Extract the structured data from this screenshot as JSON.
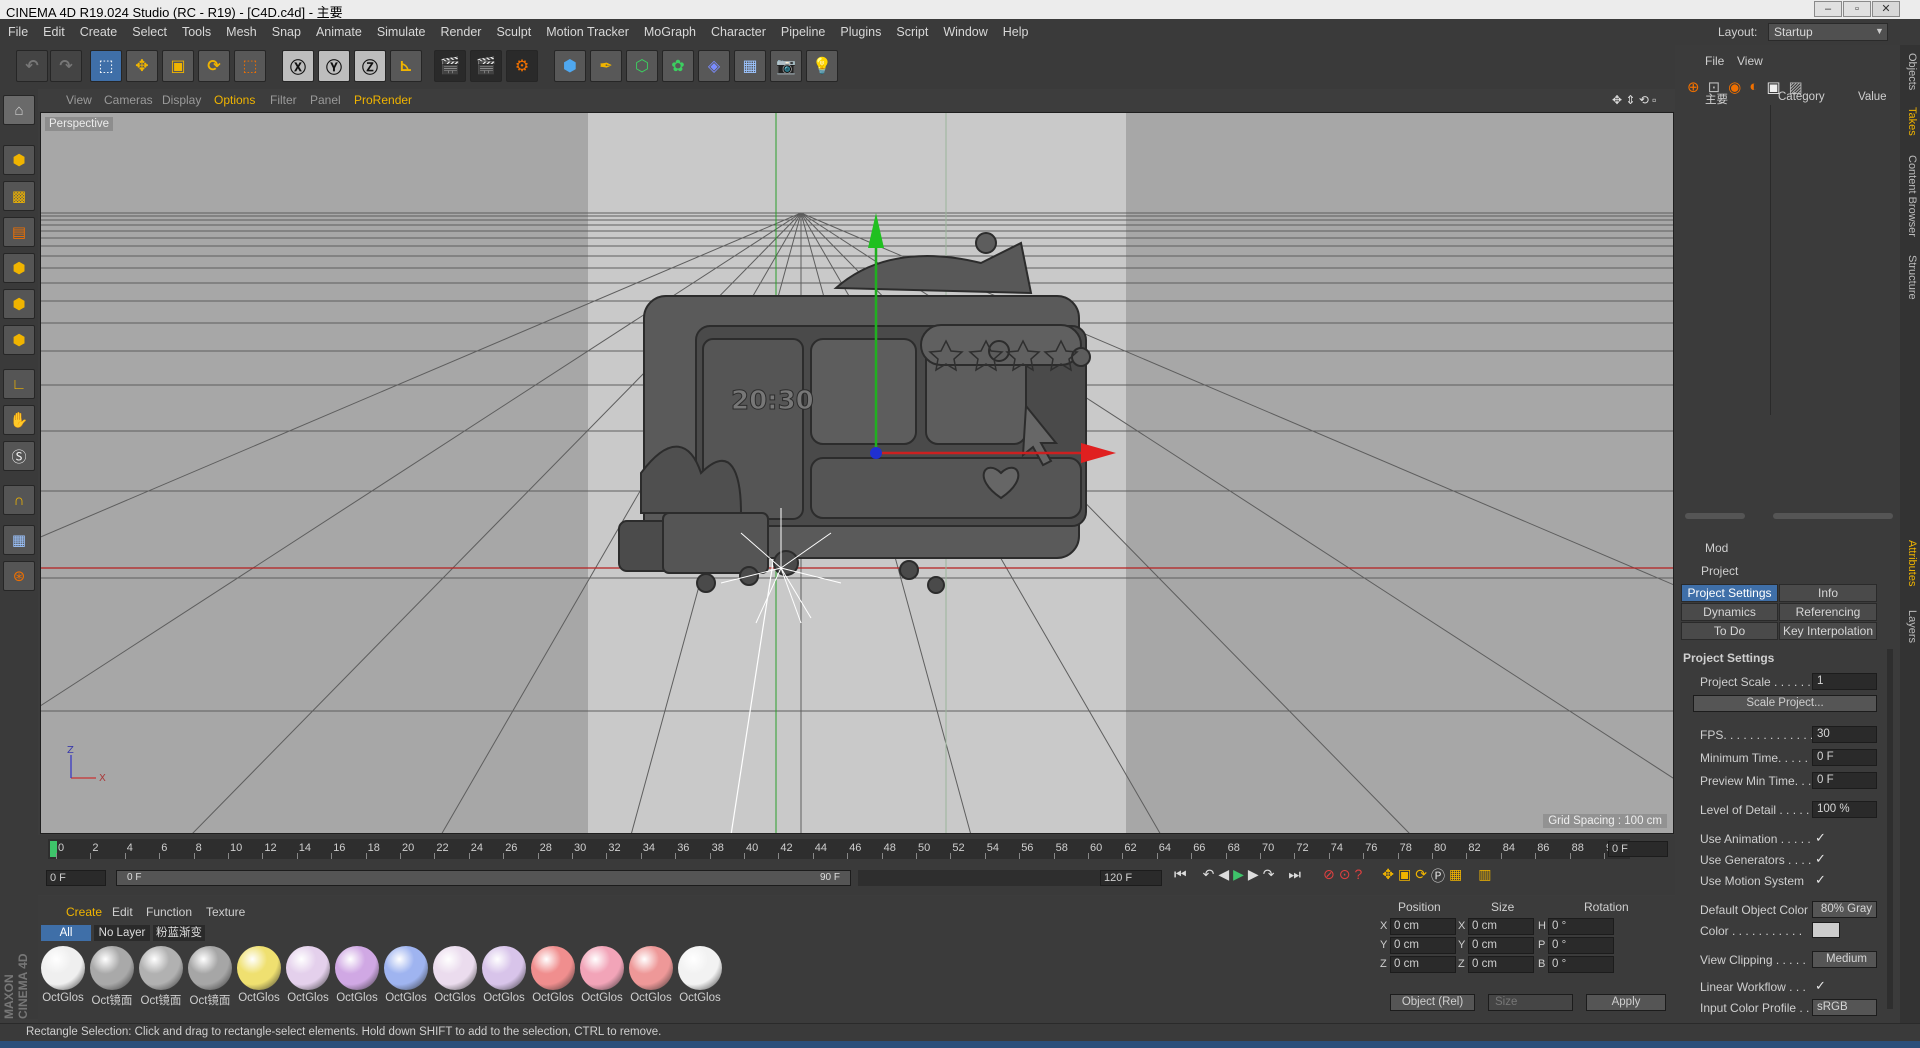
{
  "window": {
    "title": "CINEMA 4D R19.024 Studio (RC - R19) - [C4D.c4d] - 主要"
  },
  "menu": [
    "File",
    "Edit",
    "Create",
    "Select",
    "Tools",
    "Mesh",
    "Snap",
    "Animate",
    "Simulate",
    "Render",
    "Sculpt",
    "Motion Tracker",
    "MoGraph",
    "Character",
    "Pipeline",
    "Plugins",
    "Script",
    "Window",
    "Help"
  ],
  "layout": {
    "label": "Layout:",
    "value": "Startup"
  },
  "viewport_menu": [
    "View",
    "Cameras",
    "Display",
    "Options",
    "Filter",
    "Panel",
    "ProRender"
  ],
  "viewport": {
    "label": "Perspective",
    "grid_spacing": "Grid Spacing : 100 cm",
    "clock_text": "20:30",
    "axis_z": "Z",
    "axis_x": "X"
  },
  "timeline": {
    "ticks": [
      "0",
      "2",
      "4",
      "6",
      "8",
      "10",
      "12",
      "14",
      "16",
      "18",
      "20",
      "22",
      "24",
      "26",
      "28",
      "30",
      "32",
      "34",
      "36",
      "38",
      "40",
      "42",
      "44",
      "46",
      "48",
      "50",
      "52",
      "54",
      "56",
      "58",
      "60",
      "62",
      "64",
      "66",
      "68",
      "70",
      "72",
      "74",
      "76",
      "78",
      "80",
      "82",
      "84",
      "86",
      "88",
      "90"
    ],
    "current_frame": "0 F",
    "start": "0 F",
    "slider_start": "0 F",
    "slider_end": "90 F",
    "end": "120 F"
  },
  "materials": {
    "menu": [
      "Create",
      "Edit",
      "Function",
      "Texture"
    ],
    "filters": [
      "All",
      "No Layer",
      "粉蓝渐变"
    ],
    "items": [
      {
        "label": "OctGlos",
        "color": "#efefef"
      },
      {
        "label": "Oct镜面",
        "color": "#a9a9a9"
      },
      {
        "label": "Oct镜面",
        "color": "#b1b1b1"
      },
      {
        "label": "Oct镜面",
        "color": "#a6a6a6"
      },
      {
        "label": "OctGlos",
        "color": "#efe070"
      },
      {
        "label": "OctGlos",
        "color": "#e4d0ec"
      },
      {
        "label": "OctGlos",
        "color": "#d0a8e4"
      },
      {
        "label": "OctGlos",
        "color": "#9fb4f0"
      },
      {
        "label": "OctGlos",
        "color": "#ebdcee"
      },
      {
        "label": "OctGlos",
        "color": "#d8c4ea"
      },
      {
        "label": "OctGlos",
        "color": "#f08e8e"
      },
      {
        "label": "OctGlos",
        "color": "#f2a4b8"
      },
      {
        "label": "OctGlos",
        "color": "#ee9898"
      },
      {
        "label": "OctGlos",
        "color": "#f2f2f2"
      }
    ]
  },
  "coords": {
    "headers": [
      "Position",
      "Size",
      "Rotation"
    ],
    "rows": [
      {
        "pl": "X",
        "pv": "0 cm",
        "sl": "X",
        "sv": "0 cm",
        "rl": "H",
        "rv": "0 °"
      },
      {
        "pl": "Y",
        "pv": "0 cm",
        "sl": "Y",
        "sv": "0 cm",
        "rl": "P",
        "rv": "0 °"
      },
      {
        "pl": "Z",
        "pv": "0 cm",
        "sl": "Z",
        "sv": "0 cm",
        "rl": "B",
        "rv": "0 °"
      }
    ],
    "mode": "Object (Rel)",
    "size_mode": "Size",
    "apply": "Apply"
  },
  "objects": {
    "menu": [
      "File",
      "View"
    ],
    "columns": [
      "主要",
      "Category",
      "Value"
    ]
  },
  "attributes": {
    "mode": "Mod",
    "object": "Project",
    "tabs": [
      "Project Settings",
      "Info",
      "Dynamics",
      "Referencing",
      "To Do",
      "Key Interpolation"
    ],
    "section": "Project Settings",
    "scale_label": "Project Scale . . . . . .",
    "scale_value": "1",
    "scale_button": "Scale Project...",
    "fps_label": "FPS. . . . . . . . . . . . . .",
    "fps_value": "30",
    "min_time_label": "Minimum Time. . . . .",
    "min_time_value": "0 F",
    "preview_min_label": "Preview Min Time. . .",
    "preview_min_value": "0 F",
    "lod_label": "Level of Detail . . . . .",
    "lod_value": "100 %",
    "use_animation": "Use Animation . . . . .",
    "use_generators": "Use Generators . . . .",
    "use_motion": "Use Motion System",
    "default_color_label": "Default Object Color",
    "default_color_value": "80% Gray",
    "color_label": "Color . . . . . . . . . . .",
    "view_clipping_label": "View Clipping . . . . .",
    "view_clipping_value": "Medium",
    "linear_workflow": "Linear Workflow . . .",
    "input_profile_label": "Input Color Profile . .",
    "input_profile_value": "sRGB"
  },
  "side_tabs": [
    "Objects",
    "Takes",
    "Content Browser",
    "Structure",
    "Attributes",
    "Layers"
  ],
  "brand": "MAXON CINEMA 4D",
  "status": "Rectangle Selection: Click and drag to rectangle-select elements. Hold down SHIFT to add to the selection, CTRL to remove."
}
